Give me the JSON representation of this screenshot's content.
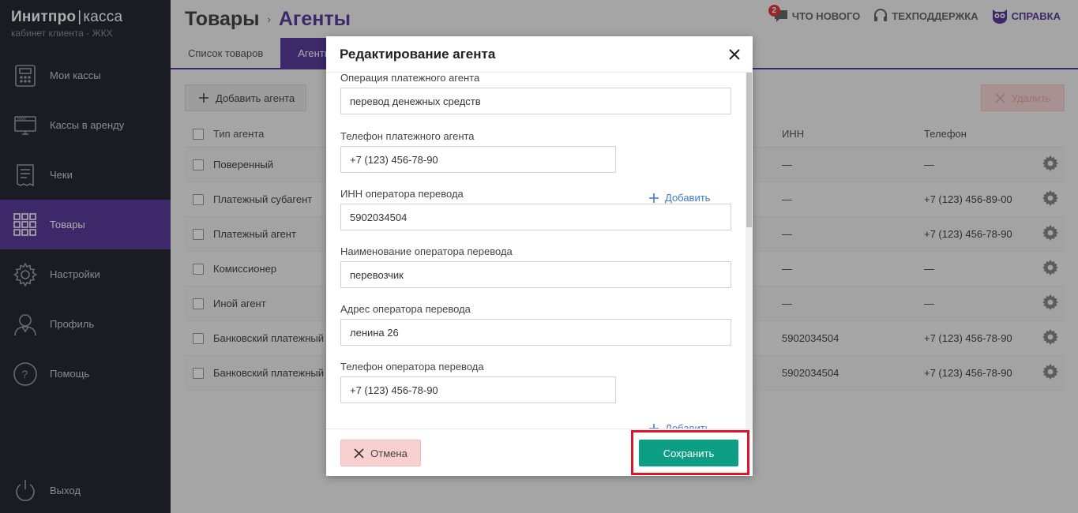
{
  "brand": {
    "name_bold": "Инитпро",
    "separator": "|",
    "name_light": "касса",
    "subtitle": "кабинет клиента - ЖКХ"
  },
  "sidebar": {
    "items": [
      {
        "label": "Мои кассы",
        "icon": "register-icon"
      },
      {
        "label": "Кассы в аренду",
        "icon": "www-monitor-icon"
      },
      {
        "label": "Чеки",
        "icon": "receipt-icon"
      },
      {
        "label": "Товары",
        "icon": "grid-icon",
        "active": true
      },
      {
        "label": "Настройки",
        "icon": "gear-icon"
      },
      {
        "label": "Профиль",
        "icon": "user-icon"
      },
      {
        "label": "Помощь",
        "icon": "question-icon"
      }
    ],
    "logout_label": "Выход"
  },
  "header": {
    "crumb1": "Товары",
    "crumb_sep": "›",
    "crumb2": "Агенты",
    "news_label": "ЧТО НОВОГО",
    "news_badge": "2",
    "support_label": "ТЕХПОДДЕРЖКА",
    "help_label": "СПРАВКА"
  },
  "tabs": [
    {
      "label": "Список товаров"
    },
    {
      "label": "Агенты",
      "active": true
    }
  ],
  "toolbar": {
    "add_label": "Добавить агента",
    "delete_label": "Удалить"
  },
  "table": {
    "headers": {
      "type": "Тип агента",
      "inn": "ИНН",
      "phone": "Телефон"
    },
    "rows": [
      {
        "type": "Поверенный",
        "inn": "—",
        "phone": "—"
      },
      {
        "type": "Платежный субагент",
        "inn": "—",
        "phone": "+7 (123) 456-89-00"
      },
      {
        "type": "Платежный агент",
        "inn": "—",
        "phone": "+7 (123) 456-78-90"
      },
      {
        "type": "Комиссионер",
        "inn": "—",
        "phone": "—"
      },
      {
        "type": "Иной агент",
        "inn": "—",
        "phone": "—"
      },
      {
        "type": "Банковский платежный",
        "inn": "5902034504",
        "phone": "+7 (123) 456-78-90"
      },
      {
        "type": "Банковский платежный",
        "inn": "5902034504",
        "phone": "+7 (123) 456-78-90"
      }
    ]
  },
  "modal": {
    "title": "Редактирование агента",
    "fields": {
      "operation_label": "Операция платежного агента",
      "operation_value": "перевод денежных средств",
      "agent_phone_label": "Телефон платежного агента",
      "agent_phone_value": "+7 (123) 456-78-90",
      "inn_label": "ИНН оператора перевода",
      "inn_value": "5902034504",
      "op_name_label": "Наименование оператора перевода",
      "op_name_value": "перевозчик",
      "op_address_label": "Адрес оператора перевода",
      "op_address_value": "ленина 26",
      "op_phone_label": "Телефон оператора перевода",
      "op_phone_value": "+7 (123) 456-78-90"
    },
    "add_label": "Добавить",
    "cancel_label": "Отмена",
    "save_label": "Сохранить"
  },
  "colors": {
    "sidebar_bg": "#262a33",
    "accent": "#5b3d9c",
    "save": "#0c9f86",
    "cancel_bg": "#f9d0d0",
    "highlight": "#e0142b",
    "link": "#3d7bd0"
  }
}
